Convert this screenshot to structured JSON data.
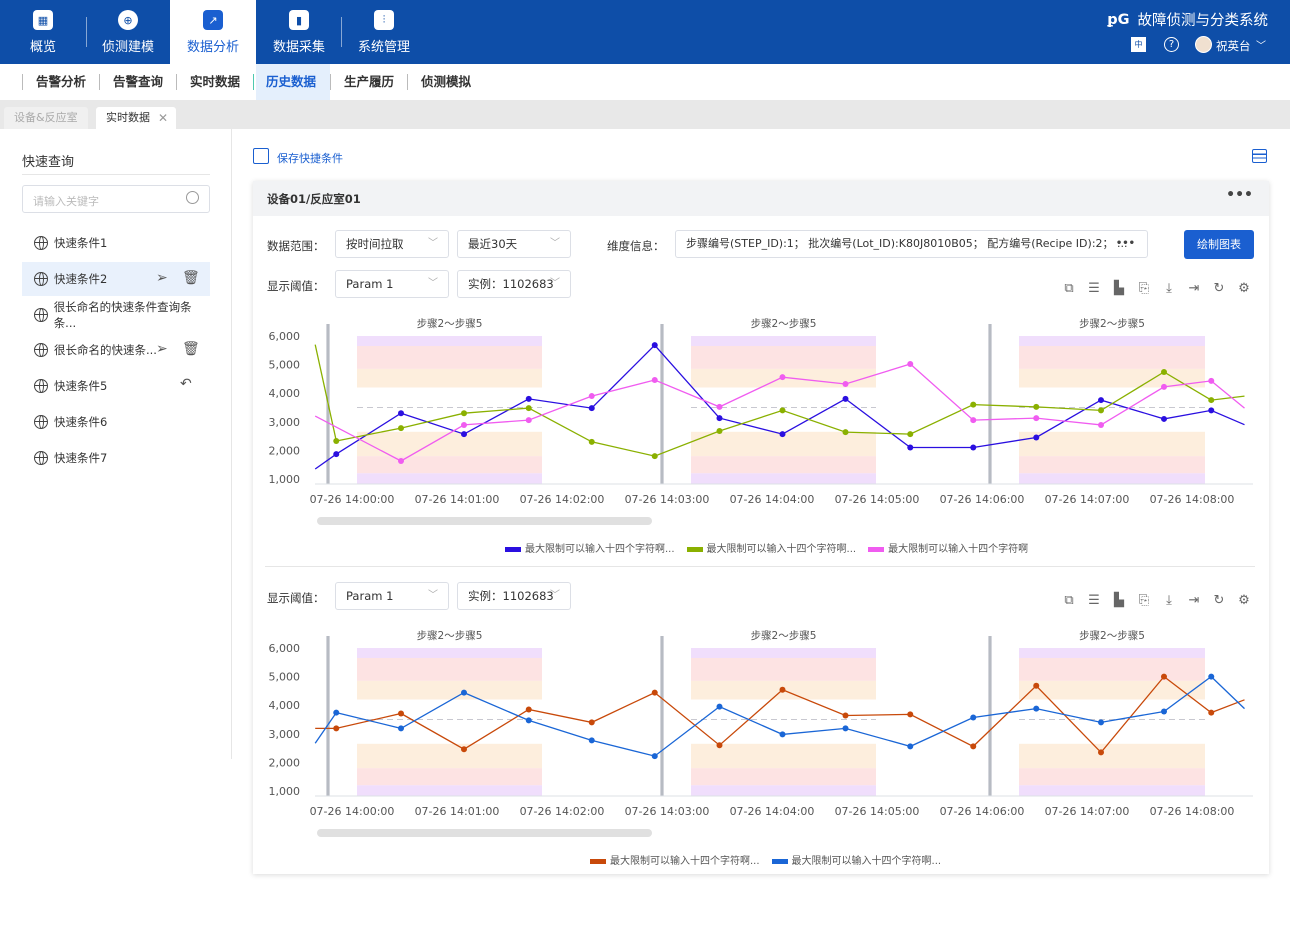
{
  "header": {
    "brand": "故障侦测与分类系统",
    "user": "祝英台",
    "nav": [
      {
        "label": "概览",
        "icon": "grid-icon"
      },
      {
        "label": "侦测建模",
        "icon": "globe-icon"
      },
      {
        "label": "数据分析",
        "icon": "line-chart-icon",
        "active": true
      },
      {
        "label": "数据采集",
        "icon": "bar-chart-icon"
      },
      {
        "label": "系统管理",
        "icon": "sliders-icon"
      }
    ]
  },
  "subnav": [
    {
      "label": "告警分析"
    },
    {
      "label": "告警查询"
    },
    {
      "label": "实时数据"
    },
    {
      "label": "历史数据",
      "active": true
    },
    {
      "label": "生产履历"
    },
    {
      "label": "侦测模拟"
    }
  ],
  "tabs": [
    {
      "label": "设备&反应室"
    },
    {
      "label": "实时数据",
      "active": true
    }
  ],
  "sidebar": {
    "title": "快速查询",
    "search_placeholder": "请输入关键字",
    "items": [
      {
        "label": "快速条件1"
      },
      {
        "label": "快速条件2"
      },
      {
        "label": "很长命名的快速条件查询条条..."
      },
      {
        "label": "很长命名的快速条..."
      },
      {
        "label": "快速条件5"
      },
      {
        "label": "快速条件6"
      },
      {
        "label": "快速条件7"
      }
    ]
  },
  "main": {
    "save_label": "保存快捷条件",
    "card_title": "设备01/反应室01",
    "range_label": "数据范围：",
    "range_mode": "按时间拉取",
    "range_period": "最近30天",
    "dim_label": "维度信息：",
    "dim_value": "步骤编号(STEP_ID):1； 批次编号(Lot_ID):K80J8010B05； 配方编号(Recipe ID):2； ...",
    "draw_label": "绘制图表",
    "threshold_label": "显示阈值：",
    "param": "Param 1",
    "instance": "实例：1102683"
  },
  "colors": {
    "primary": "#1a5fd0",
    "header": "#0e4ea8"
  },
  "chart_data": [
    {
      "type": "line",
      "ylim": [
        1000,
        6000
      ],
      "yticks": [
        "1,000",
        "2,000",
        "3,000",
        "4,000",
        "5,000",
        "6,000"
      ],
      "xticks": [
        "07-26 14:00:00",
        "07-26 14:01:00",
        "07-26 14:02:00",
        "07-26 14:03:00",
        "07-26 14:04:00",
        "07-26 14:05:00",
        "07-26 14:06:00",
        "07-26 14:07:00",
        "07-26 14:08:00"
      ],
      "step_label": "步骤2～步骤5",
      "threshold": 3500,
      "x": [
        "13:59:39",
        "13:59:51",
        "14:00:28",
        "14:01:04",
        "14:01:41",
        "14:02:17",
        "14:02:53",
        "14:03:30",
        "14:04:06",
        "14:04:42",
        "14:05:19",
        "14:05:55",
        "14:06:31",
        "14:07:08",
        "14:07:44",
        "14:08:11",
        "14:08:30"
      ],
      "series": [
        {
          "name": "最大限制可以输入十四个字符啊...",
          "color": "#2a0fe0",
          "values": [
            1350,
            1870,
            3300,
            2570,
            3800,
            3480,
            5680,
            3130,
            2570,
            3800,
            2100,
            2100,
            2450,
            3760,
            3100,
            3400,
            2900
          ]
        },
        {
          "name": "最大限制可以输入十四个字符啊...",
          "color": "#8ab000",
          "values": [
            5700,
            2330,
            2780,
            3300,
            3480,
            2300,
            1800,
            2680,
            3400,
            2640,
            2570,
            3600,
            3520,
            3400,
            4740,
            3760,
            3900
          ]
        },
        {
          "name": "最大限制可以输入十四个字符啊",
          "color": "#f05cf0",
          "values": [
            3200,
            null,
            1630,
            2890,
            3060,
            3900,
            4460,
            3520,
            4560,
            4320,
            5020,
            3060,
            3130,
            2890,
            4220,
            4430,
            3480
          ]
        }
      ]
    },
    {
      "type": "line",
      "ylim": [
        1000,
        6000
      ],
      "yticks": [
        "1,000",
        "2,000",
        "3,000",
        "4,000",
        "5,000",
        "6,000"
      ],
      "xticks": [
        "07-26 14:00:00",
        "07-26 14:01:00",
        "07-26 14:02:00",
        "07-26 14:03:00",
        "07-26 14:04:00",
        "07-26 14:05:00",
        "07-26 14:06:00",
        "07-26 14:07:00",
        "07-26 14:08:00"
      ],
      "step_label": "步骤2～步骤5",
      "threshold": 3500,
      "x": [
        "13:59:39",
        "13:59:51",
        "14:00:28",
        "14:01:04",
        "14:01:41",
        "14:02:17",
        "14:02:53",
        "14:03:30",
        "14:04:06",
        "14:04:42",
        "14:05:19",
        "14:05:55",
        "14:06:31",
        "14:07:08",
        "14:07:44",
        "14:08:11",
        "14:08:30"
      ],
      "series": [
        {
          "name": "最大限制可以输入十四个字符啊...",
          "color": "#c8490a",
          "values": [
            3190,
            3190,
            3710,
            2460,
            3850,
            3400,
            4440,
            2600,
            4540,
            3640,
            3680,
            2560,
            4680,
            2350,
            5000,
            3740,
            4190
          ]
        },
        {
          "name": "最大限制可以输入十四个字符啊...",
          "color": "#1a66d6",
          "values": [
            2670,
            3740,
            3190,
            4440,
            3470,
            2770,
            2220,
            3950,
            2980,
            3190,
            2560,
            3570,
            3880,
            3400,
            3780,
            5000,
            3880
          ]
        }
      ]
    }
  ]
}
